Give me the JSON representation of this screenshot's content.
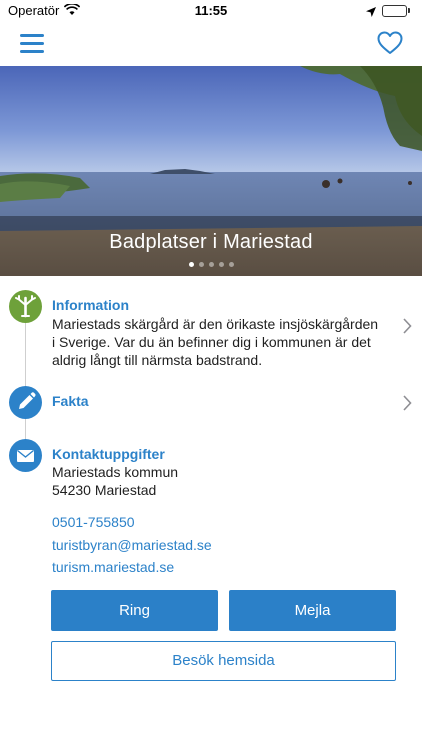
{
  "status_bar": {
    "carrier": "Operatör",
    "time": "11:55"
  },
  "hero": {
    "title": "Badplatser i Mariestad",
    "page_count": 5,
    "active_page": 1
  },
  "information": {
    "title": "Information",
    "text_lines": [
      "Mariestads skärgård är den örikaste insjöskärgården",
      "i Sverige. Var du än befinner dig i kommunen är det",
      "aldrig långt till närmsta badstrand."
    ]
  },
  "fakta": {
    "title": "Fakta"
  },
  "contact": {
    "title": "Kontaktuppgifter",
    "name": "Mariestads kommun",
    "address": "54230 Mariestad",
    "phone": "0501-755850",
    "email": "turistbyran@mariestad.se",
    "website": "turism.mariestad.se"
  },
  "buttons": {
    "call": "Ring",
    "mail": "Mejla",
    "visit": "Besök hemsida"
  },
  "colors": {
    "accent": "#2c82c9",
    "button": "#2b80c8",
    "info_icon": "#6ea13a",
    "battery": "#4cd964"
  },
  "icons": {
    "info": "tree-icon",
    "fakta": "pencil-icon",
    "contact": "envelope-icon"
  }
}
